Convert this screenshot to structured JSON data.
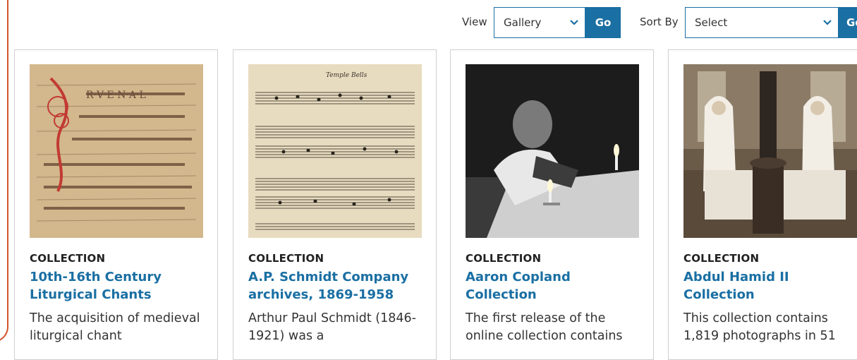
{
  "toolbar": {
    "view_label": "View",
    "view_value": "Gallery",
    "go_label": "Go",
    "sort_label": "Sort By",
    "sort_value": "Select",
    "sort_go_label": "Go",
    "accent_color": "#1a6fa3"
  },
  "cards": [
    {
      "kicker": "COLLECTION",
      "title": "10th-16th Century Liturgical Chants",
      "desc": "The acquisition of medieval liturgical chant",
      "image": "medieval-manuscript"
    },
    {
      "kicker": "COLLECTION",
      "title": "A.P. Schmidt Company archives, 1869-1958",
      "desc": "Arthur Paul Schmidt (1846-1921) was a",
      "image": "sheet-music"
    },
    {
      "kicker": "COLLECTION",
      "title": "Aaron Copland Collection",
      "desc": "The first release of the online collection contains",
      "image": "copland-candle-photo"
    },
    {
      "kicker": "COLLECTION",
      "title": "Abdul Hamid II Collection",
      "desc": "This collection contains 1,819 photographs in 51",
      "image": "nurses-ward-photo"
    }
  ]
}
